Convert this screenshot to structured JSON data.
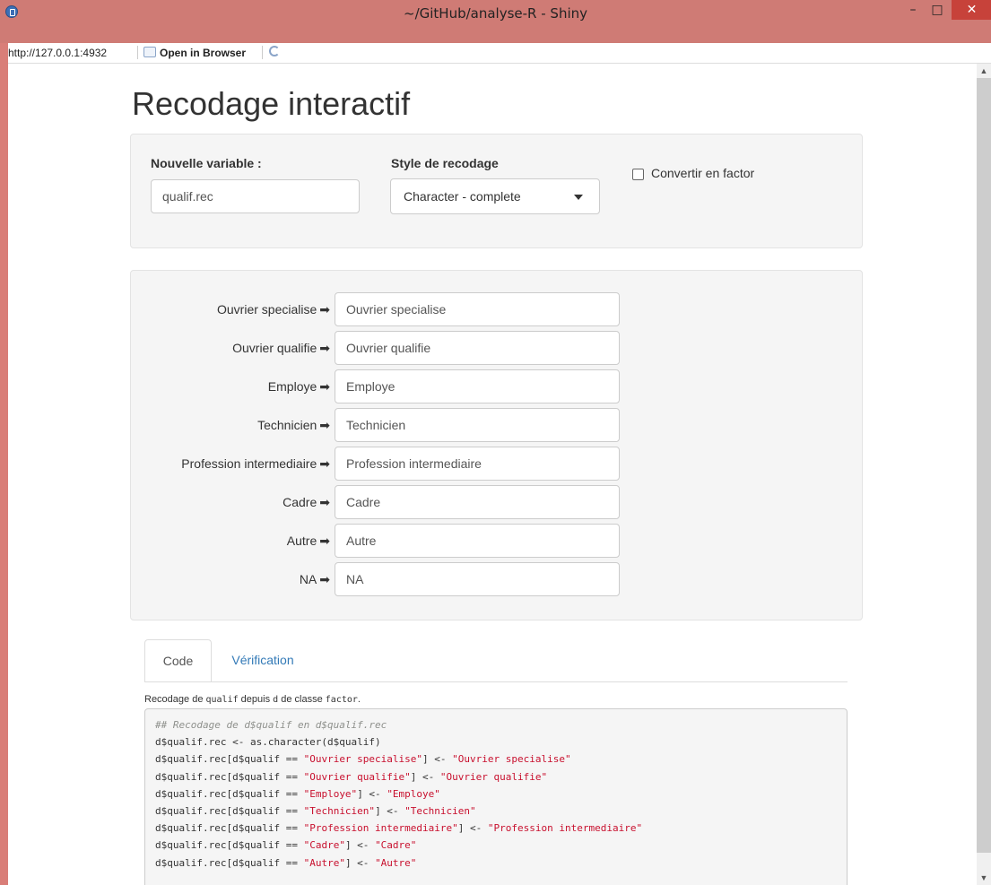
{
  "window": {
    "title": "~/GitHub/analyse-R - Shiny",
    "minimize": "–",
    "maximize": "□",
    "close": "✕"
  },
  "address_bar": {
    "url": "http://127.0.0.1:4932",
    "open_in_browser": "Open in Browser"
  },
  "page": {
    "title": "Recodage interactif"
  },
  "settings": {
    "new_variable_label": "Nouvelle variable :",
    "new_variable_value": "qualif.rec",
    "style_label": "Style de recodage",
    "style_value": "Character - complete",
    "convert_label": "Convertir en factor",
    "convert_checked": false
  },
  "recode": {
    "rows": [
      {
        "label": "Ouvrier specialise",
        "value": "Ouvrier specialise"
      },
      {
        "label": "Ouvrier qualifie",
        "value": "Ouvrier qualifie"
      },
      {
        "label": "Employe",
        "value": "Employe"
      },
      {
        "label": "Technicien",
        "value": "Technicien"
      },
      {
        "label": "Profession intermediaire",
        "value": "Profession intermediaire"
      },
      {
        "label": "Cadre",
        "value": "Cadre"
      },
      {
        "label": "Autre",
        "value": "Autre"
      },
      {
        "label": "NA",
        "value": "NA"
      }
    ]
  },
  "tabs": {
    "code": "Code",
    "verification": "Vérification",
    "active": "Code"
  },
  "description": {
    "prefix": "Recodage de ",
    "var": "qualif",
    "middle": " depuis ",
    "data": "d",
    "middle2": " de classe ",
    "cls": "factor",
    "suffix": "."
  },
  "code": {
    "lines": [
      [
        {
          "t": "## Recodage de d$qualif en d$qualif.rec",
          "k": "comment"
        }
      ],
      [
        {
          "t": "d$qualif.rec <- as.character(d$qualif)",
          "k": "plain"
        }
      ],
      [
        {
          "t": "d$qualif.rec[d$qualif == ",
          "k": "plain"
        },
        {
          "t": "\"Ouvrier specialise\"",
          "k": "str"
        },
        {
          "t": "] <- ",
          "k": "plain"
        },
        {
          "t": "\"Ouvrier specialise\"",
          "k": "str"
        }
      ],
      [
        {
          "t": "d$qualif.rec[d$qualif == ",
          "k": "plain"
        },
        {
          "t": "\"Ouvrier qualifie\"",
          "k": "str"
        },
        {
          "t": "] <- ",
          "k": "plain"
        },
        {
          "t": "\"Ouvrier qualifie\"",
          "k": "str"
        }
      ],
      [
        {
          "t": "d$qualif.rec[d$qualif == ",
          "k": "plain"
        },
        {
          "t": "\"Employe\"",
          "k": "str"
        },
        {
          "t": "] <- ",
          "k": "plain"
        },
        {
          "t": "\"Employe\"",
          "k": "str"
        }
      ],
      [
        {
          "t": "d$qualif.rec[d$qualif == ",
          "k": "plain"
        },
        {
          "t": "\"Technicien\"",
          "k": "str"
        },
        {
          "t": "] <- ",
          "k": "plain"
        },
        {
          "t": "\"Technicien\"",
          "k": "str"
        }
      ],
      [
        {
          "t": "d$qualif.rec[d$qualif == ",
          "k": "plain"
        },
        {
          "t": "\"Profession intermediaire\"",
          "k": "str"
        },
        {
          "t": "] <- ",
          "k": "plain"
        },
        {
          "t": "\"Profession intermediaire\"",
          "k": "str"
        }
      ],
      [
        {
          "t": "d$qualif.rec[d$qualif == ",
          "k": "plain"
        },
        {
          "t": "\"Cadre\"",
          "k": "str"
        },
        {
          "t": "] <- ",
          "k": "plain"
        },
        {
          "t": "\"Cadre\"",
          "k": "str"
        }
      ],
      [
        {
          "t": "d$qualif.rec[d$qualif == ",
          "k": "plain"
        },
        {
          "t": "\"Autre\"",
          "k": "str"
        },
        {
          "t": "] <- ",
          "k": "plain"
        },
        {
          "t": "\"Autre\"",
          "k": "str"
        }
      ]
    ]
  },
  "colors": {
    "titlebar": "#cf7b75",
    "link": "#337ab7",
    "code_string": "#c8102e",
    "code_comment": "#8e908c"
  },
  "icons": {
    "app": "r-logo-icon",
    "open_in_browser": "browser-window-icon",
    "refresh": "refresh-icon",
    "arrow": "arrow-right-icon",
    "caret": "caret-down-icon"
  }
}
